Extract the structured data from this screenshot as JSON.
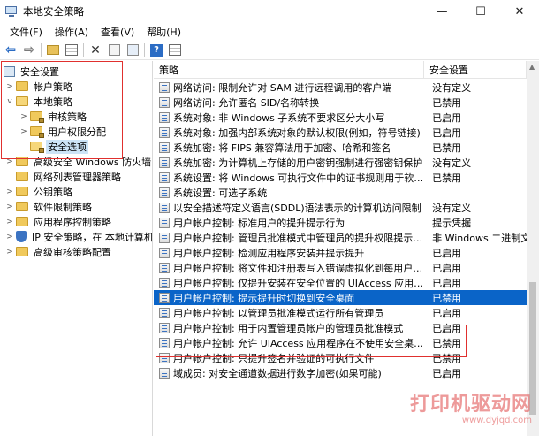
{
  "window": {
    "title": "本地安全策略",
    "minimize": "—",
    "maximize": "☐",
    "close": "✕"
  },
  "menu": [
    "文件(F)",
    "操作(A)",
    "查看(V)",
    "帮助(H)"
  ],
  "toolbar_icons": [
    "back-icon",
    "forward-icon",
    "folder-up-icon",
    "show-hide-tree-icon",
    "delete-icon",
    "properties-icon",
    "export-list-icon",
    "help-icon",
    "view-icon"
  ],
  "tree": {
    "root": "安全设置",
    "items": [
      {
        "label": "帐户策略",
        "chevron": ">"
      },
      {
        "label": "本地策略",
        "chevron": "v"
      },
      {
        "label": "审核策略",
        "chevron": ">"
      },
      {
        "label": "用户权限分配",
        "chevron": ">"
      },
      {
        "label": "安全选项",
        "chevron": ""
      },
      {
        "label": "高级安全 Windows 防火墙",
        "chevron": ">"
      },
      {
        "label": "网络列表管理器策略",
        "chevron": ""
      },
      {
        "label": "公钥策略",
        "chevron": ">"
      },
      {
        "label": "软件限制策略",
        "chevron": ">"
      },
      {
        "label": "应用程序控制策略",
        "chevron": ">"
      },
      {
        "label": "IP 安全策略，在 本地计算机",
        "chevron": ">"
      },
      {
        "label": "高级审核策略配置",
        "chevron": ">"
      }
    ]
  },
  "list": {
    "columns": [
      "策略",
      "安全设置"
    ],
    "rows": [
      {
        "policy": "网络访问: 限制允许对 SAM 进行远程调用的客户端",
        "setting": "没有定义"
      },
      {
        "policy": "网络访问: 允许匿名 SID/名称转换",
        "setting": "已禁用"
      },
      {
        "policy": "系统对象: 非 Windows 子系统不要求区分大小写",
        "setting": "已启用"
      },
      {
        "policy": "系统对象: 加强内部系统对象的默认权限(例如，符号链接)",
        "setting": "已启用"
      },
      {
        "policy": "系统加密: 将 FIPS 兼容算法用于加密、哈希和签名",
        "setting": "已禁用"
      },
      {
        "policy": "系统加密: 为计算机上存储的用户密钥强制进行强密钥保护",
        "setting": "没有定义"
      },
      {
        "policy": "系统设置: 将 Windows 可执行文件中的证书规则用于软件...",
        "setting": "已禁用"
      },
      {
        "policy": "系统设置: 可选子系统",
        "setting": ""
      },
      {
        "policy": "以安全描述符定义语言(SDDL)语法表示的计算机访问限制",
        "setting": "没有定义"
      },
      {
        "policy": "用户帐户控制: 标准用户的提升提示行为",
        "setting": "提示凭据"
      },
      {
        "policy": "用户帐户控制: 管理员批准模式中管理员的提升权限提示的...",
        "setting": "非 Windows 二进制文"
      },
      {
        "policy": "用户帐户控制: 检测应用程序安装并提示提升",
        "setting": "已启用"
      },
      {
        "policy": "用户帐户控制: 将文件和注册表写入错误虚拟化到每用户位置",
        "setting": "已启用"
      },
      {
        "policy": "用户帐户控制: 仅提升安装在安全位置的 UIAccess 应用程序",
        "setting": "已启用"
      },
      {
        "policy": "用户帐户控制: 提示提升时切换到安全桌面",
        "setting": "已禁用"
      },
      {
        "policy": "用户帐户控制: 以管理员批准模式运行所有管理员",
        "setting": "已启用"
      },
      {
        "policy": "用户帐户控制: 用于内置管理员帐户的管理员批准模式",
        "setting": "已启用"
      },
      {
        "policy": "用户帐户控制: 允许 UIAccess 应用程序在不使用安全桌面...",
        "setting": "已禁用"
      },
      {
        "policy": "用户帐户控制: 只提升签名并验证的可执行文件",
        "setting": "已禁用"
      },
      {
        "policy": "域成员: 对安全通道数据进行数字加密(如果可能)",
        "setting": "已启用"
      }
    ],
    "selected_row": 14
  },
  "watermark": {
    "main": "打印机驱动网",
    "sub": "www.dyjqd.com"
  }
}
